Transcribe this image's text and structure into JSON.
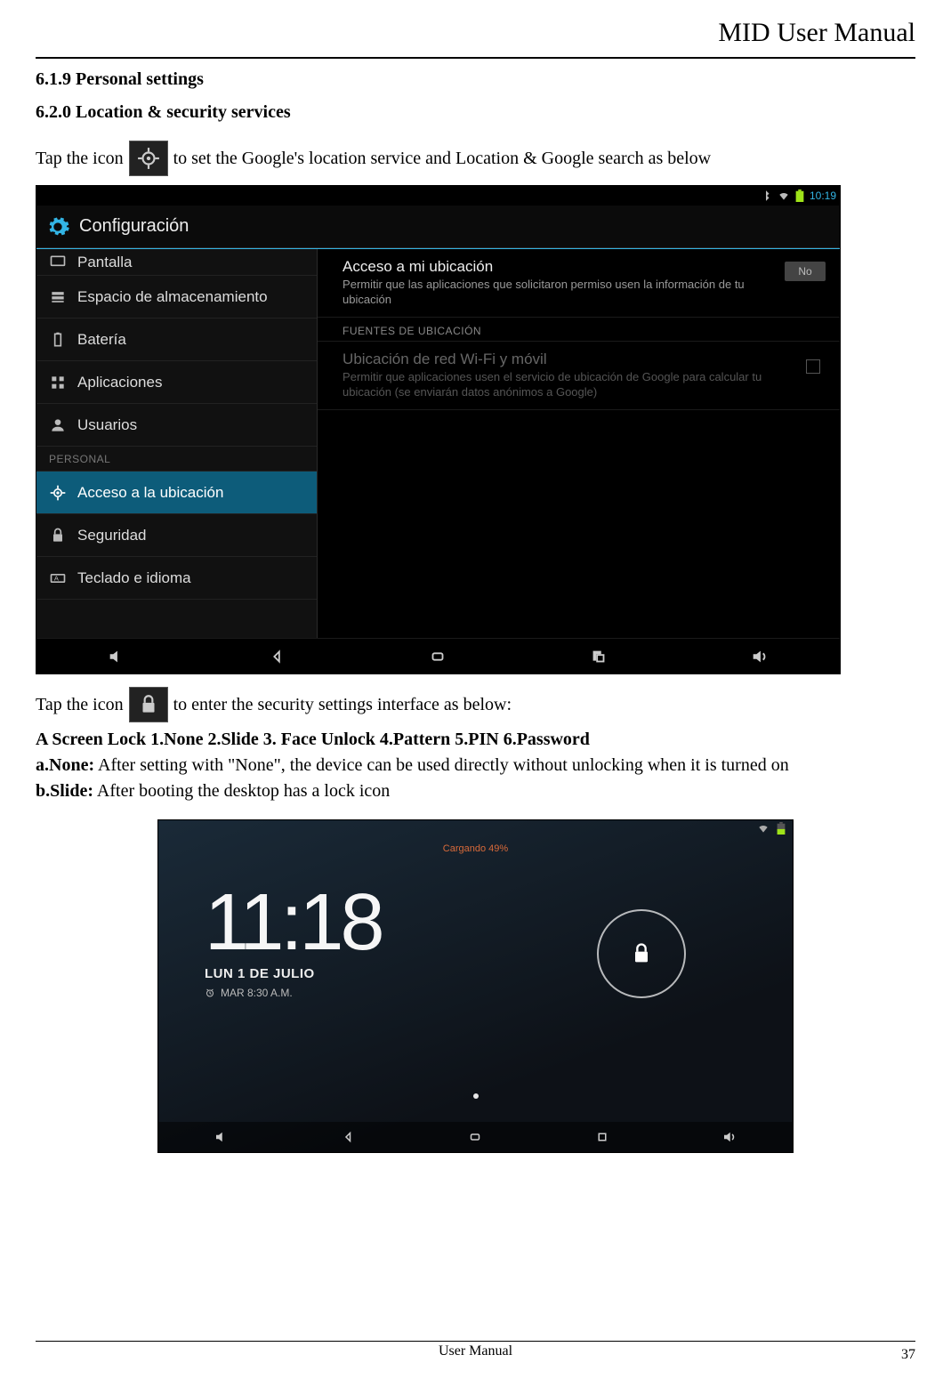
{
  "doc": {
    "header": "MID User Manual",
    "h1": "6.1.9 Personal settings",
    "h2": "6.2.0 Location & security services",
    "line1a": "Tap the icon",
    "line1b": " to set the Google's location service and Location & Google search as below",
    "line2a": "Tap the icon",
    "line2b": " to enter the security settings interface as below:",
    "screenlock_line": "A Screen Lock 1.None    2.Slide    3. Face Unlock    4.Pattern      5.PIN    6.Password",
    "a_none_label": "a.None:",
    "a_none_text": " After setting with \"None\", the device can be used directly without unlocking when it is turned on",
    "b_slide_label": "b.Slide:",
    "b_slide_text": " After booting the desktop has a lock icon",
    "footer": "User Manual",
    "page": "37"
  },
  "shot1": {
    "clock": "10:19",
    "appbar_title": "Configuración",
    "left": {
      "pantalla": "Pantalla",
      "almac": "Espacio de almacenamiento",
      "bateria": "Batería",
      "apps": "Aplicaciones",
      "usuarios": "Usuarios",
      "personal_hdr": "PERSONAL",
      "acceso": "Acceso a la ubicación",
      "seguridad": "Seguridad",
      "teclado": "Teclado e idioma"
    },
    "right": {
      "pref1_title": "Acceso a mi ubicación",
      "pref1_sub": "Permitir que las aplicaciones que solicitaron permiso usen la información de tu ubicación",
      "toggle": "No",
      "section_hdr": "FUENTES DE UBICACIÓN",
      "pref2_title": "Ubicación de red Wi-Fi y móvil",
      "pref2_sub": "Permitir que aplicaciones usen el servicio de ubicación de Google para calcular tu ubicación (se enviarán datos anónimos a Google)"
    }
  },
  "shot2": {
    "charge": "Cargando 49%",
    "time": "11:18",
    "date": "LUN 1 DE JULIO",
    "alarm": "MAR 8:30 A.M."
  }
}
